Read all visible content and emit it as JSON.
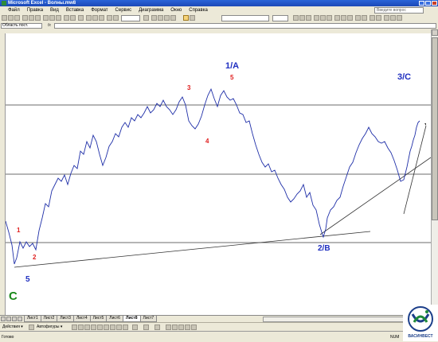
{
  "window": {
    "title": "Microsoft Excel - Волны.mw8"
  },
  "menu": {
    "items": [
      "Файл",
      "Правка",
      "Вид",
      "Вставка",
      "Формат",
      "Сервис",
      "Диаграмма",
      "Окно",
      "Справка"
    ],
    "help_placeholder": "Введите вопрос"
  },
  "formula_bar": {
    "name_box": "Область пост.",
    "fx": "fx",
    "formula": ""
  },
  "chart": {
    "wave_labels": [
      {
        "text": "1/A",
        "color": "#1f2fc0"
      },
      {
        "text": "3/C",
        "color": "#1f2fc0"
      },
      {
        "text": "2/B",
        "color": "#1f2fc0"
      },
      {
        "text": "5",
        "color": "#1f2fc0"
      },
      {
        "text": "C",
        "color": "#1a8a1a"
      },
      {
        "text": "1",
        "color": "#e02020"
      },
      {
        "text": "2",
        "color": "#e02020"
      },
      {
        "text": "3",
        "color": "#e02020"
      },
      {
        "text": "4",
        "color": "#e02020"
      },
      {
        "text": "5",
        "color": "#e02020"
      }
    ]
  },
  "sheets": {
    "tabs": [
      "Лист1",
      "Лист2",
      "Лист3",
      "Лист4",
      "Лист5",
      "Лист6",
      "Лист8",
      "Лист7"
    ],
    "active": "Лист8"
  },
  "drawing_bar": {
    "actions_label": "Действия ▾",
    "autoshapes_label": "Автофигуры ▾"
  },
  "status": {
    "ready": "Готово",
    "num": "NUM"
  },
  "logo": {
    "text": "ВАСИНВЕСТ"
  }
}
